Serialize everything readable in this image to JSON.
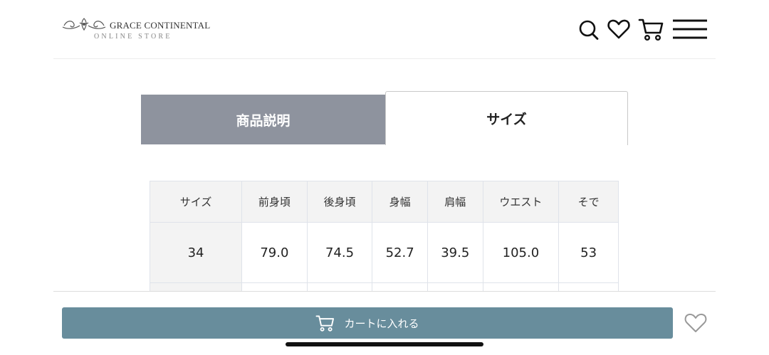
{
  "header": {
    "logo_title": "GRACE CONTINENTAL",
    "logo_subtitle": "ONLINE STORE",
    "icons": [
      "search-icon",
      "heart-icon",
      "cart-icon",
      "hamburger-menu-icon"
    ]
  },
  "tabs": [
    {
      "label": "商品説明",
      "active": false
    },
    {
      "label": "サイズ",
      "active": true
    }
  ],
  "size_table": {
    "headers": [
      "サイズ",
      "前身頃",
      "後身頃",
      "身幅",
      "肩幅",
      "ウエスト",
      "そで"
    ],
    "rows": [
      [
        "34",
        "79.0",
        "74.5",
        "52.7",
        "39.5",
        "105.0",
        "53"
      ]
    ]
  },
  "bottom_bar": {
    "cart_button_label": "カートに入れる",
    "favorite_icon": "heart-outline-icon"
  },
  "colors": {
    "tab_inactive_bg": "#8e939e",
    "cart_button_bg": "#688d9c",
    "table_header_bg": "#f3f3f3",
    "table_border": "#dfe3ea"
  }
}
